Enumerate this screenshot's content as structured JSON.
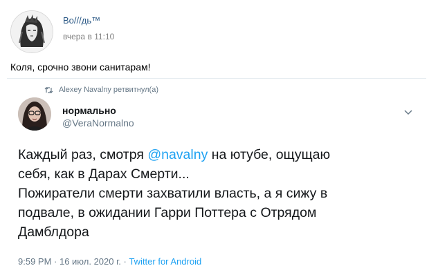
{
  "post": {
    "author_name": "Во///дь™",
    "time": "вчера в 11:10",
    "text": "Коля, срочно звони санитарам!"
  },
  "tweet": {
    "retweet_label": "Alexey Navalny ретвитнул(а)",
    "display_name": "нормально",
    "handle": "@VeraNormalno",
    "body": {
      "line1_before": "Каждый раз, смотря ",
      "mention": "@navalny",
      "line1_after": " на ютубе, ощущаю",
      "line2": "себя, как в Дарах Смерти...",
      "line3": "Пожиратели смерти захватили власть, а я сижу в",
      "line4": "подвале, в ожидании Гарри Поттера с Отрядом",
      "line5": "Дамблдора"
    },
    "meta": {
      "timestamp": "9:59 PM · 16 июл. 2020 г. · ",
      "source": "Twitter for Android"
    }
  },
  "colors": {
    "vk_link": "#2a5885",
    "twitter_blue": "#1da1f2",
    "muted": "#657786"
  }
}
